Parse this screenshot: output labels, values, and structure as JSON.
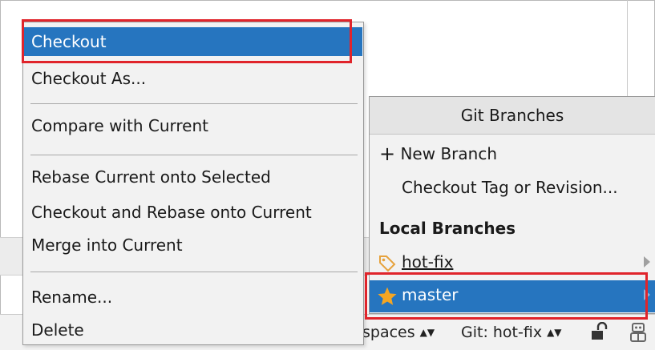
{
  "context_menu": {
    "items": [
      {
        "label": "Checkout"
      },
      {
        "label": "Checkout As..."
      },
      {
        "label": "Compare with Current"
      },
      {
        "label": "Rebase Current onto Selected"
      },
      {
        "label": "Checkout and Rebase onto Current"
      },
      {
        "label": "Merge into Current"
      },
      {
        "label": "Rename..."
      },
      {
        "label": "Delete"
      }
    ]
  },
  "git_branches": {
    "title": "Git Branches",
    "new_branch": "New Branch",
    "checkout_tag": "Checkout Tag or Revision...",
    "local_branches_heading": "Local Branches",
    "branches": [
      {
        "name": "hot-fix",
        "icon": "tag-icon"
      },
      {
        "name": "master",
        "icon": "star-icon"
      }
    ]
  },
  "status_bar": {
    "indent": "spaces",
    "git_branch": "Git: hot-fix"
  },
  "colors": {
    "selection": "#2675bf",
    "annotation": "#e0242b",
    "star": "#f5a623"
  }
}
